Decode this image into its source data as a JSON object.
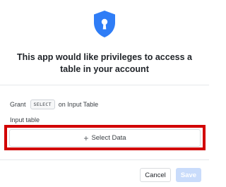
{
  "dialog": {
    "icon": "shield-lock-icon",
    "title": "This app would like privileges to access a table in your account",
    "grant": {
      "prefix": "Grant",
      "privilege": "SELECT",
      "suffix": "on Input Table"
    },
    "field_label": "Input table",
    "select_button": {
      "icon": "plus-icon",
      "label": "Select Data"
    },
    "cancel_label": "Cancel",
    "save_label": "Save"
  },
  "colors": {
    "accent": "#2f7df6",
    "highlight": "#d20000",
    "save_disabled": "#c9dcfb"
  }
}
